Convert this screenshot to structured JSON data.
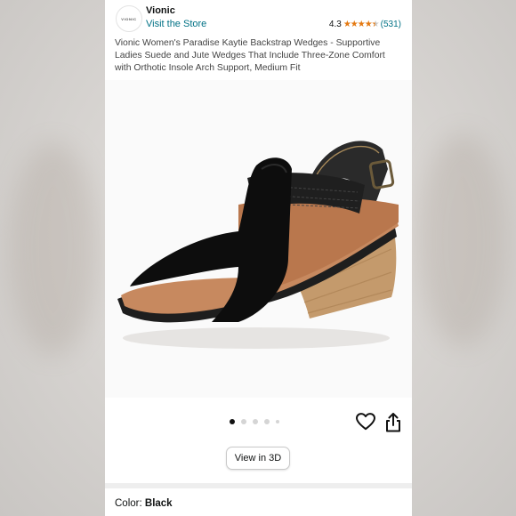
{
  "store": {
    "logo_text": "VIONIC",
    "brand_name": "Vionic",
    "visit_link": "Visit the Store"
  },
  "rating": {
    "value": "4.3",
    "stars_shown": 4.3,
    "count": "(531)"
  },
  "product": {
    "title": "Vionic Women's Paradise Kaytie Backstrap Wedges - Supportive Ladies Suede and Jute Wedges That Include Three-Zone Comfort with Orthotic Insole Arch Support, Medium Fit"
  },
  "gallery": {
    "image_count": 5,
    "active_index": 0,
    "view3d_label": "View in 3D"
  },
  "color": {
    "label": "Color:",
    "value": "Black"
  },
  "icons": {
    "favorite": "heart-icon",
    "share": "share-icon"
  },
  "palette": {
    "link": "#007185",
    "star": "#e47911",
    "text": "#0f1111"
  }
}
